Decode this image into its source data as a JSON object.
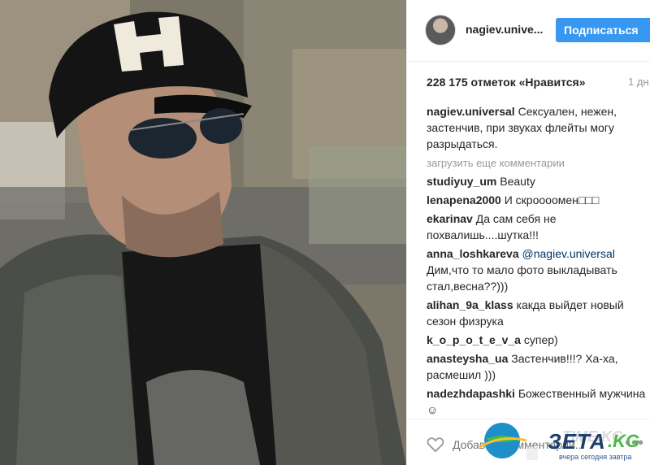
{
  "post": {
    "username": "nagiev.universal",
    "username_display": "nagiev.unive...",
    "follow_label": "Подписаться",
    "likes": "228 175 отметок «Нравится»",
    "time": "1 дн."
  },
  "caption": {
    "user": "nagiev.universal",
    "text": "Сексуален, нежен, застенчив, при звуках флейты могу разрыдаться."
  },
  "load_more_label": "загрузить еще комментарии",
  "comments": [
    {
      "user": "studiyuy_um",
      "text": "Beauty"
    },
    {
      "user": "lenapena2000",
      "text": "И скроооомен□□□"
    },
    {
      "user": "ekarinav",
      "text": "Да сам себя не похвалишь....шутка!!!"
    },
    {
      "user": "anna_loshkareva",
      "mention": "@nagiev.universal",
      "text": "Дим,что то мало фото выкладывать стал,весна??)))"
    },
    {
      "user": "alihan_9a_klass",
      "text": "какда выйдет новый сезон физрука"
    },
    {
      "user": "k_o_p_o_t_e_v_a",
      "text": "супер)"
    },
    {
      "user": "anasteysha_ua",
      "text": "Застенчив!!!? Ха-ха, расмешил )))"
    },
    {
      "user": "nadezhdapashki",
      "text": "Божественный мужчина☺"
    }
  ],
  "footer": {
    "comment_placeholder": "Добавьте комментарий...",
    "more_label": "•••"
  },
  "watermarks": {
    "timekg": "TIME.KG",
    "zeta_brand": "ЗЕТА",
    "zeta_tld": ".KG",
    "zeta_tagline": "вчера сегодня завтра"
  },
  "colors": {
    "accent": "#3897f0",
    "text": "#262626",
    "muted": "#999999",
    "mention": "#003569"
  },
  "icons": [
    "heart-icon",
    "more-options-icon",
    "avatar",
    "globe-logo-icon"
  ]
}
